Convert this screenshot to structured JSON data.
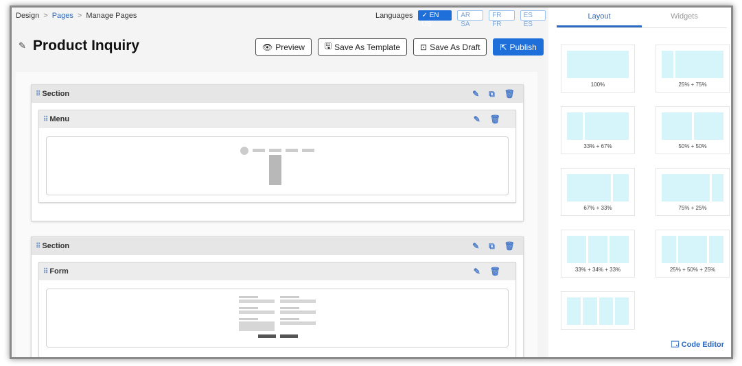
{
  "breadcrumb": {
    "items": [
      "Design",
      "Pages",
      "Manage Pages"
    ],
    "separator": ">"
  },
  "languages": {
    "label": "Languages",
    "options": [
      {
        "code": "EN US",
        "active": true
      },
      {
        "code": "AR SA",
        "active": false
      },
      {
        "code": "FR FR",
        "active": false
      },
      {
        "code": "ES ES",
        "active": false
      }
    ]
  },
  "page": {
    "title": "Product Inquiry"
  },
  "toolbar": {
    "preview_label": "Preview",
    "save_template_label": "Save As Template",
    "save_draft_label": "Save As Draft",
    "publish_label": "Publish"
  },
  "canvas": {
    "sections": [
      {
        "label": "Section",
        "widget": {
          "label": "Menu",
          "kind": "menu"
        }
      },
      {
        "label": "Section",
        "widget": {
          "label": "Form",
          "kind": "form"
        }
      }
    ]
  },
  "panel": {
    "tabs": [
      {
        "label": "Layout",
        "active": true
      },
      {
        "label": "Widgets",
        "active": false
      }
    ],
    "layouts": [
      "100%",
      "25% + 75%",
      "33% + 67%",
      "50% + 50%",
      "67% + 33%",
      "75% + 25%",
      "33% + 34% + 33%",
      "25% + 50% + 25%",
      ""
    ],
    "code_editor_label": "Code Editor"
  },
  "colors": {
    "accent": "#1e6fd9",
    "link": "#2a6ac0",
    "column_fill": "#d6f5fb"
  }
}
